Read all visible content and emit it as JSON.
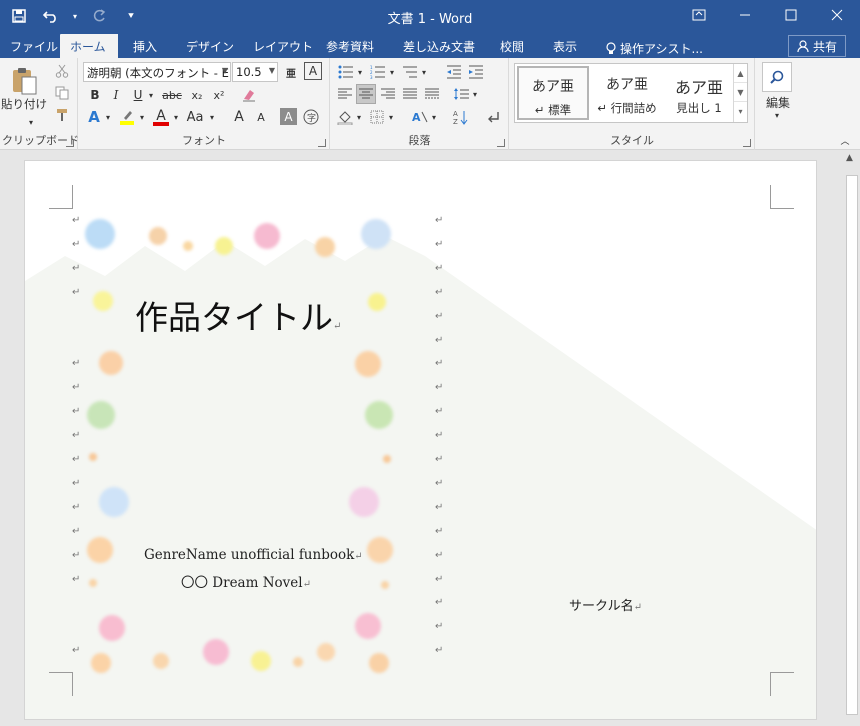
{
  "window": {
    "title": "文書 1 - Word",
    "qat": {
      "save_icon": "save-icon",
      "undo_icon": "undo-icon",
      "redo_icon": "redo-icon",
      "customize_icon": "customize-qat-icon"
    }
  },
  "tabs": [
    {
      "label": "ファイル",
      "active": false
    },
    {
      "label": "ホーム",
      "active": true
    },
    {
      "label": "挿入",
      "active": false
    },
    {
      "label": "デザイン",
      "active": false
    },
    {
      "label": "レイアウト",
      "active": false
    },
    {
      "label": "参考資料",
      "active": false
    },
    {
      "label": "差し込み文書",
      "active": false
    },
    {
      "label": "校閲",
      "active": false
    },
    {
      "label": "表示",
      "active": false
    }
  ],
  "tell_me": "操作アシスト...",
  "share_label": "共有",
  "ribbon": {
    "clipboard": {
      "paste_label": "貼り付け",
      "group_label": "クリップボード"
    },
    "font": {
      "group_label": "フォント",
      "font_name": "游明朝 (本文のフォント - E",
      "font_size": "10.5",
      "bold": "B",
      "italic": "I",
      "underline": "U",
      "strike": "abc",
      "subscript": "x₂",
      "superscript": "x²",
      "text_effects": "A",
      "font_color": "A",
      "case": "Aa",
      "grow": "A",
      "shrink": "A",
      "shading": "A"
    },
    "paragraph": {
      "group_label": "段落"
    },
    "styles": {
      "group_label": "スタイル",
      "items": [
        {
          "sample": "あア亜",
          "name": "↵ 標準",
          "selected": true
        },
        {
          "sample": "あア亜",
          "name": "↵ 行間詰め",
          "selected": false
        },
        {
          "sample": "あア亜",
          "name": "見出し 1",
          "selected": false
        }
      ]
    },
    "editing": {
      "label": "編集"
    }
  },
  "document": {
    "title": "作品タイトル",
    "genre_line": "GenreName unofficial funbook",
    "novel_line": "〇〇 Dream Novel",
    "circle_name": "サークル名",
    "paragraph_mark": "↵"
  }
}
